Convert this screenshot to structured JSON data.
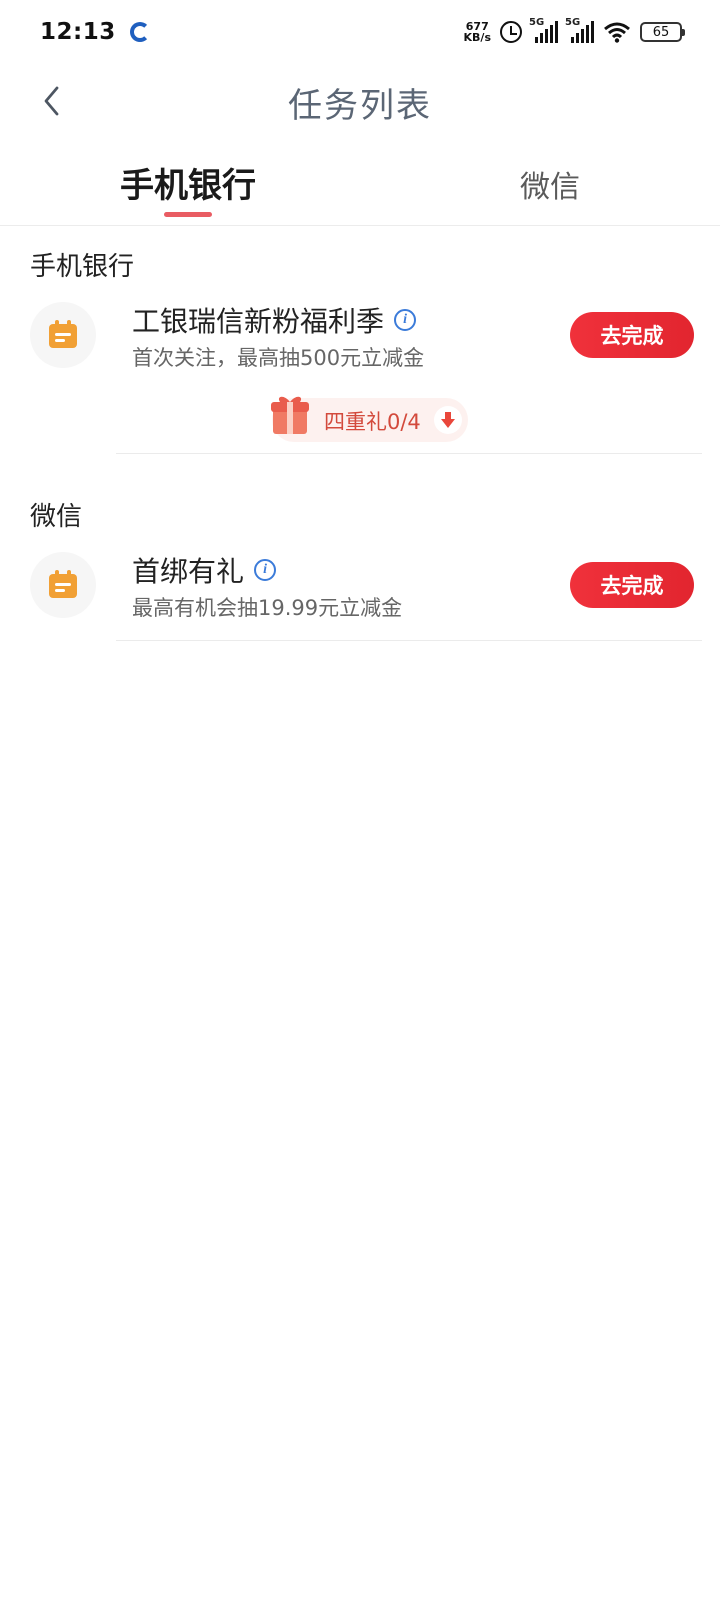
{
  "status_bar": {
    "time": "12:13",
    "net_speed_value": "677",
    "net_speed_unit": "KB/s",
    "signal_1_label": "5G",
    "signal_2_label": "5G",
    "battery": "65"
  },
  "nav": {
    "title": "任务列表"
  },
  "tabs": [
    {
      "label": "手机银行",
      "active": true
    },
    {
      "label": "微信",
      "active": false
    }
  ],
  "sections": [
    {
      "title": "手机银行",
      "tasks": [
        {
          "name": "工银瑞信新粉福利季",
          "desc": "首次关注，最高抽500元立减金",
          "button": "去完成",
          "gift_label": "四重礼0/4"
        }
      ]
    },
    {
      "title": "微信",
      "tasks": [
        {
          "name": "首绑有礼",
          "desc": "最高有机会抽19.99元立减金",
          "button": "去完成"
        }
      ]
    }
  ],
  "colors": {
    "accent": "#e95c63",
    "button": "#e62a33",
    "icon_orange": "#f1a035",
    "info_blue": "#3b7bd9"
  }
}
